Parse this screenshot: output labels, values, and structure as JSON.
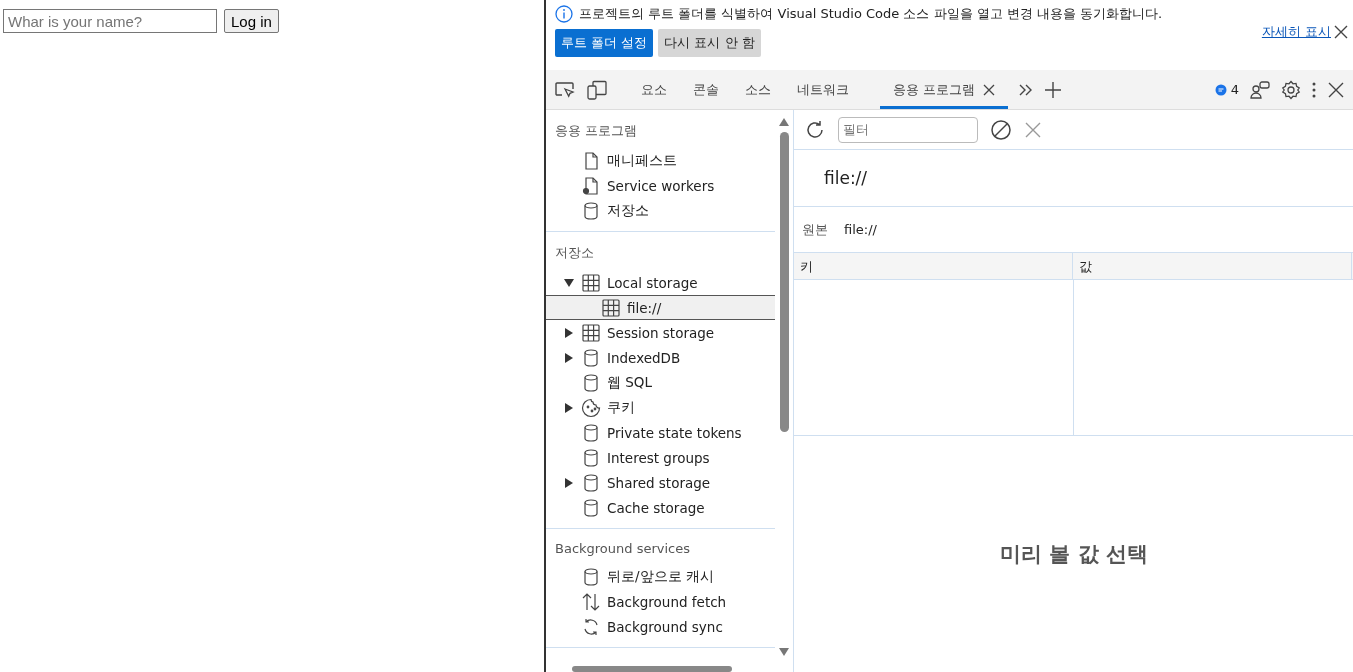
{
  "page": {
    "name_field": {
      "placeholder": "Whar is your name?"
    },
    "login_button": "Log in"
  },
  "infobar": {
    "message": "프로젝트의 루트 폴더를 식별하여 Visual Studio Code 소스 파일을 열고 변경 내용을 동기화합니다.",
    "primary_button": "루트 폴더 설정",
    "secondary_button": "다시 표시 안 함",
    "link": "자세히 표시"
  },
  "tabs": [
    {
      "label": "요소",
      "selected": false
    },
    {
      "label": "콘솔",
      "selected": false
    },
    {
      "label": "소스",
      "selected": false
    },
    {
      "label": "네트워크",
      "selected": false
    },
    {
      "label": "응용 프로그램",
      "selected": true
    }
  ],
  "issues_badge": "4",
  "sidebar": [
    {
      "title": "응용 프로그램",
      "items": [
        {
          "label": "매니페스트",
          "kind": "file",
          "selected": false
        },
        {
          "label": "Service workers",
          "kind": "gearfile",
          "selected": false
        },
        {
          "label": "저장소",
          "kind": "db",
          "selected": false
        }
      ]
    },
    {
      "title": "저장소",
      "items": [
        {
          "label": "Local storage",
          "kind": "grid",
          "expanded": true,
          "selected": false,
          "children": [
            {
              "label": "file://",
              "selected": true
            }
          ]
        },
        {
          "label": "Session storage",
          "kind": "grid",
          "expanded": false,
          "selected": false
        },
        {
          "label": "IndexedDB",
          "kind": "db",
          "expanded": false,
          "selected": false
        },
        {
          "label": "웹 SQL",
          "kind": "db",
          "selected": false
        },
        {
          "label": "쿠키",
          "kind": "cookie",
          "expanded": false,
          "selected": false
        },
        {
          "label": "Private state tokens",
          "kind": "db",
          "selected": false
        },
        {
          "label": "Interest groups",
          "kind": "db",
          "selected": false
        },
        {
          "label": "Shared storage",
          "kind": "db",
          "expanded": false,
          "selected": false
        },
        {
          "label": "Cache storage",
          "kind": "db",
          "selected": false
        }
      ]
    },
    {
      "title": "Background services",
      "items": [
        {
          "label": "뒤로/앞으로 캐시",
          "kind": "db",
          "selected": false
        },
        {
          "label": "Background fetch",
          "kind": "updown",
          "selected": false
        },
        {
          "label": "Background sync",
          "kind": "sync",
          "selected": false
        }
      ]
    }
  ],
  "filter": {
    "placeholder": "필터"
  },
  "origin_title": "file://",
  "origin": {
    "label": "원본",
    "value": "file://"
  },
  "table": {
    "columns": [
      "키",
      "값"
    ]
  },
  "empty_message": "미리 볼 값 선택"
}
